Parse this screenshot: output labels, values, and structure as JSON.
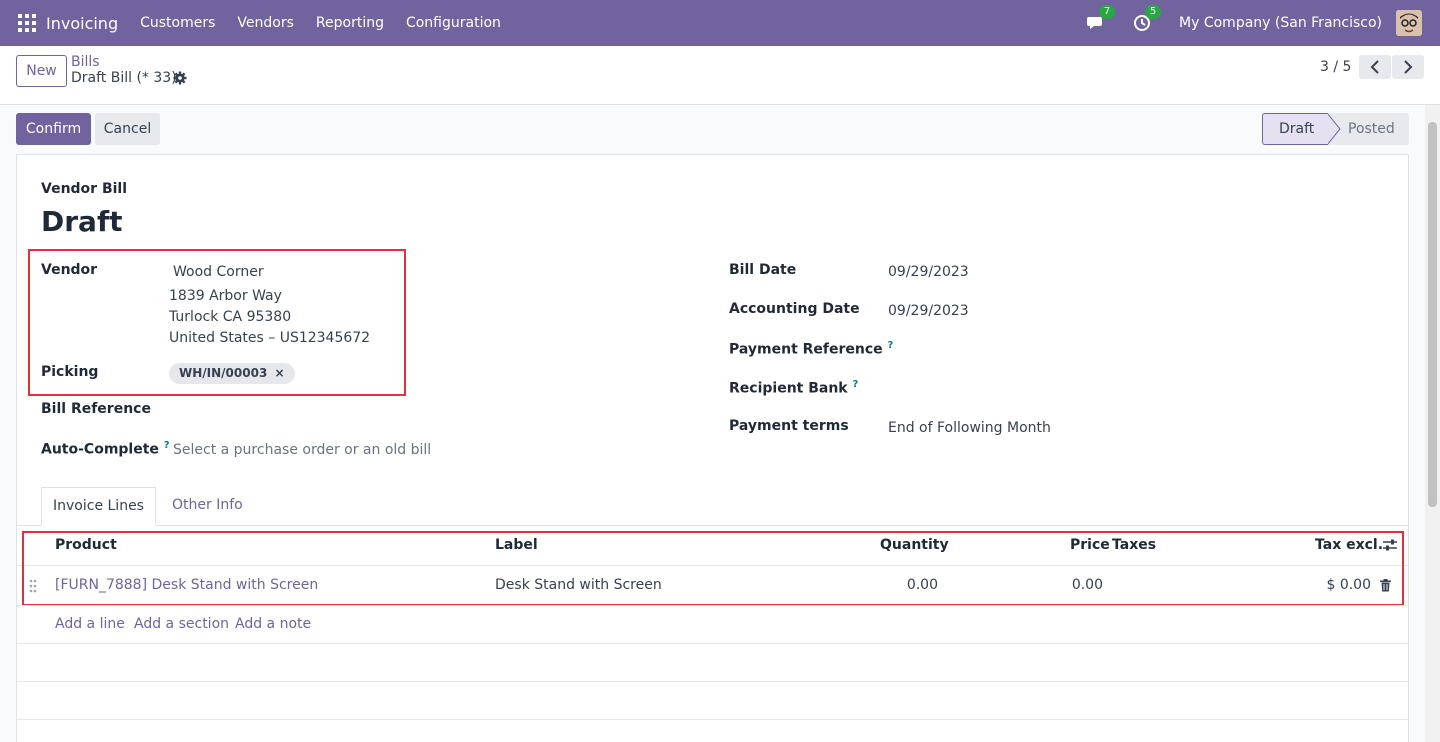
{
  "navbar": {
    "app_name": "Invoicing",
    "menu": [
      "Customers",
      "Vendors",
      "Reporting",
      "Configuration"
    ],
    "messages_count": "7",
    "activities_count": "5",
    "company": "My Company (San Francisco)"
  },
  "control": {
    "new_label": "New",
    "breadcrumb_parent": "Bills",
    "breadcrumb_current": "Draft Bill (* 33)",
    "pager": "3 / 5"
  },
  "actions": {
    "confirm_label": "Confirm",
    "cancel_label": "Cancel"
  },
  "statusbar": {
    "stages": [
      "Draft",
      "Posted"
    ],
    "active": "Draft"
  },
  "form": {
    "doc_type": "Vendor Bill",
    "title": "Draft",
    "vendor_label": "Vendor",
    "vendor_name": "Wood Corner",
    "vendor_address": [
      "1839 Arbor Way",
      "Turlock CA 95380",
      "United States – US12345672"
    ],
    "picking_label": "Picking",
    "picking_tag": "WH/IN/00003",
    "bill_reference_label": "Bill Reference",
    "auto_complete_label": "Auto-Complete",
    "auto_complete_placeholder": "Select a purchase order or an old bill",
    "bill_date_label": "Bill Date",
    "bill_date": "09/29/2023",
    "accounting_date_label": "Accounting Date",
    "accounting_date": "09/29/2023",
    "payment_reference_label": "Payment Reference",
    "recipient_bank_label": "Recipient Bank",
    "payment_terms_label": "Payment terms",
    "payment_terms": "End of Following Month",
    "help_mark": "?"
  },
  "tabs": [
    "Invoice Lines",
    "Other Info"
  ],
  "lines": {
    "columns": [
      "Product",
      "Label",
      "Quantity",
      "Price",
      "Taxes",
      "Tax excl."
    ],
    "rows": [
      {
        "product": "[FURN_7888] Desk Stand with Screen",
        "label": "Desk Stand with Screen",
        "quantity": "0.00",
        "price": "0.00",
        "taxes": "",
        "subtotal": "$ 0.00"
      }
    ],
    "add_line": "Add a line",
    "add_section": "Add a section",
    "add_note": "Add a note"
  },
  "colors": {
    "brand": "#71639e",
    "highlight_box": "#e0323c",
    "badge": "#28a745"
  }
}
